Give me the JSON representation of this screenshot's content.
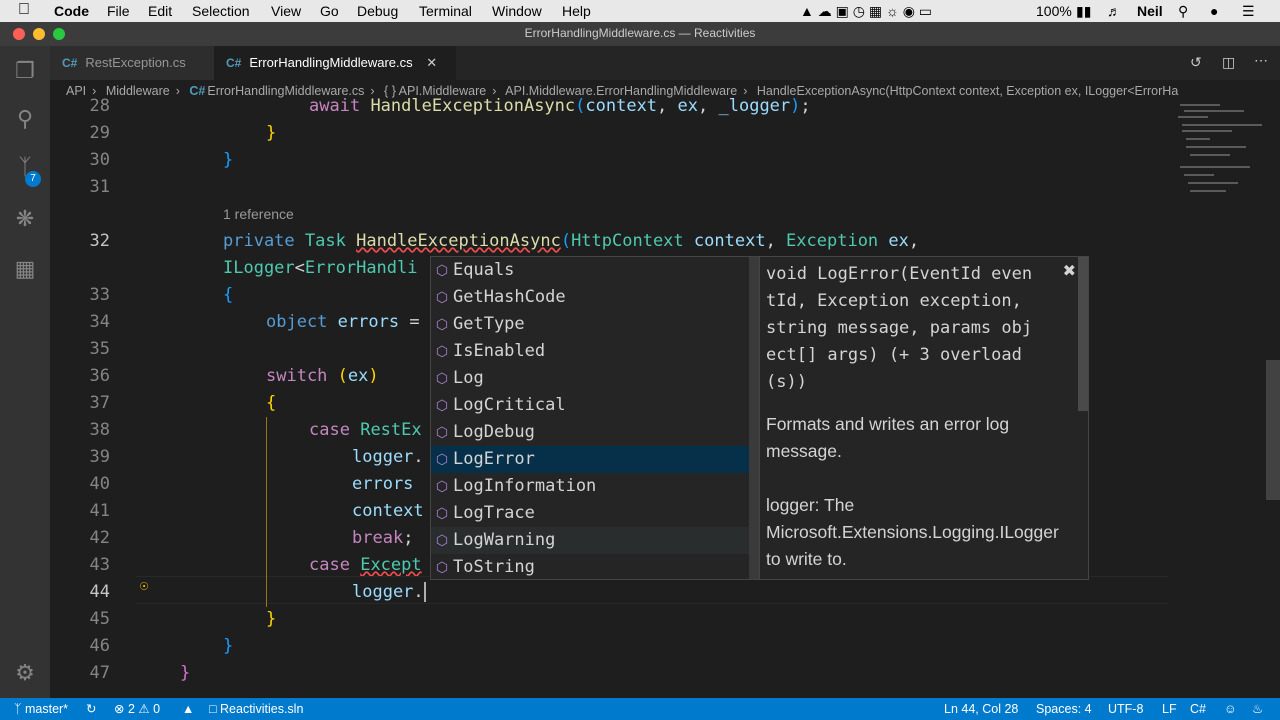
{
  "menubar": {
    "app": "Code",
    "items": [
      "File",
      "Edit",
      "Selection",
      "View",
      "Go",
      "Debug",
      "Terminal",
      "Window",
      "Help"
    ],
    "battery": "100%",
    "user": "Neil"
  },
  "window": {
    "title": "ErrorHandlingMiddleware.cs — Reactivities"
  },
  "tabs": [
    {
      "label": "RestException.cs",
      "active": false
    },
    {
      "label": "ErrorHandlingMiddleware.cs",
      "active": true
    }
  ],
  "activity": {
    "scm_badge": "7"
  },
  "breadcrumb": [
    "API",
    "Middleware",
    "ErrorHandlingMiddleware.cs",
    "{ } API.Middleware",
    "API.Middleware.ErrorHandlingMiddleware",
    "HandleExceptionAsync(HttpContext context, Exception ex, ILogger<ErrorHa"
  ],
  "editor": {
    "reference_lens": "1 reference",
    "lines": {
      "l28": "28",
      "l29": "29",
      "l30": "30",
      "l31": "31",
      "l32": "32",
      "l33": "33",
      "l34": "34",
      "l35": "35",
      "l36": "36",
      "l37": "37",
      "l38": "38",
      "l39": "39",
      "l40": "40",
      "l41": "41",
      "l42": "42",
      "l43": "43",
      "l44": "44",
      "l45": "45",
      "l46": "46",
      "l47": "47"
    }
  },
  "suggest": {
    "items": [
      "Equals",
      "GetHashCode",
      "GetType",
      "IsEnabled",
      "Log",
      "LogCritical",
      "LogDebug",
      "LogError",
      "LogInformation",
      "LogTrace",
      "LogWarning",
      "ToString"
    ],
    "selected": "LogError"
  },
  "docs": {
    "signature": "void LogError(EventId eventId, Exception exception, string message, params object[] args) (+ 3 overload(s))",
    "sig_lines": [
      "void LogError(EventId even",
      "tId, Exception exception,",
      "string message, params obj",
      "ect[] args) (+ 3 overload",
      "(s))"
    ],
    "desc_lines": [
      "Formats and writes an error log",
      "message.",
      "",
      "logger: The",
      "Microsoft.Extensions.Logging.ILogger",
      "to write to."
    ]
  },
  "statusbar": {
    "branch": "master*",
    "errors": "2",
    "warnings": "0",
    "solution": "Reactivities.sln",
    "position": "Ln 44, Col 28",
    "spaces": "Spaces: 4",
    "encoding": "UTF-8",
    "eol": "LF",
    "language": "C#"
  },
  "colors": {
    "accent": "#007acc",
    "activity": "#333333",
    "editor_bg": "#1e1e1e",
    "selected_suggest": "#062f4a"
  }
}
